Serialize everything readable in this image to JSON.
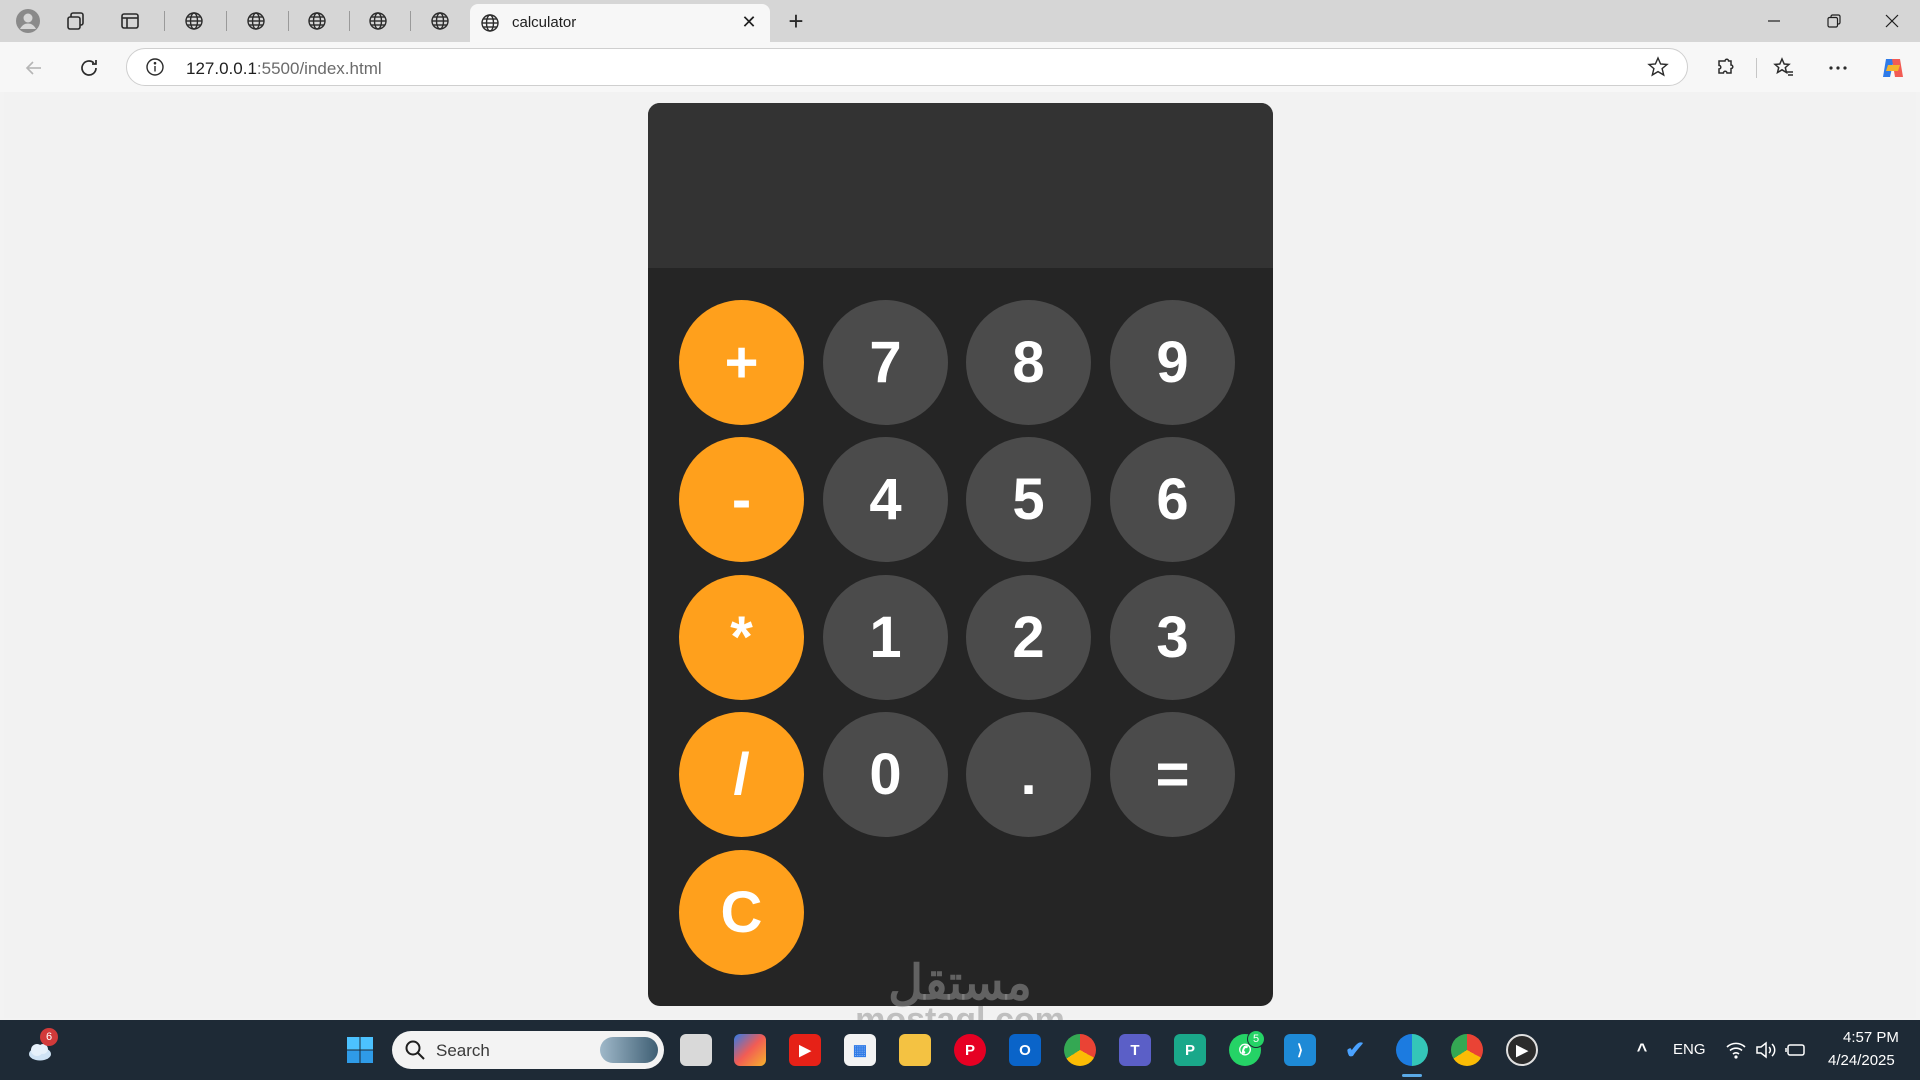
{
  "browser": {
    "tab_title": "calculator",
    "url_host": "127.0.0.1",
    "url_path": ":5500/index.html"
  },
  "calculator": {
    "display": "",
    "rows": [
      [
        "+",
        "7",
        "8",
        "9"
      ],
      [
        "-",
        "4",
        "5",
        "6"
      ],
      [
        "*",
        "1",
        "2",
        "3"
      ],
      [
        "/",
        "0",
        ".",
        "="
      ],
      [
        "C"
      ]
    ],
    "colors": {
      "operator": "#ffa01c",
      "number": "#4b4b4b",
      "body": "#252525",
      "display": "#333333"
    }
  },
  "watermark": {
    "line1": "مستقل",
    "line2": "mostaql.com"
  },
  "taskbar": {
    "search_placeholder": "Search",
    "weather_badge": "6",
    "whatsapp_badge": "5",
    "language": "ENG",
    "time": "4:57 PM",
    "date": "4/24/2025"
  }
}
